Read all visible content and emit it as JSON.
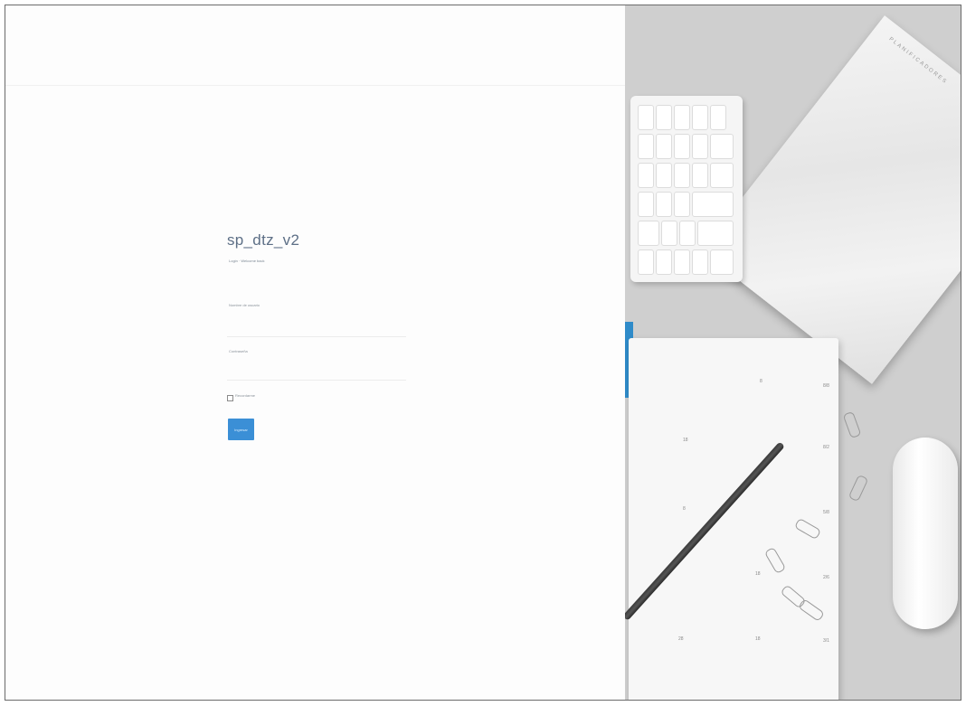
{
  "app": {
    "title": "sp_dtz_v2",
    "subtitle": "Login · Welcome back",
    "username_label": "Nombre de usuario",
    "password_label": "Contraseña",
    "remember_label": "Recordarme",
    "submit_label": "Ingresar"
  },
  "photo": {
    "description_icon": "desk-workspace-photo",
    "notebook_brand": "PLANIFICADORES"
  },
  "colors": {
    "accent": "#3b8fd6",
    "title": "#5d6f86",
    "bookmark": "#2f8bc9"
  }
}
